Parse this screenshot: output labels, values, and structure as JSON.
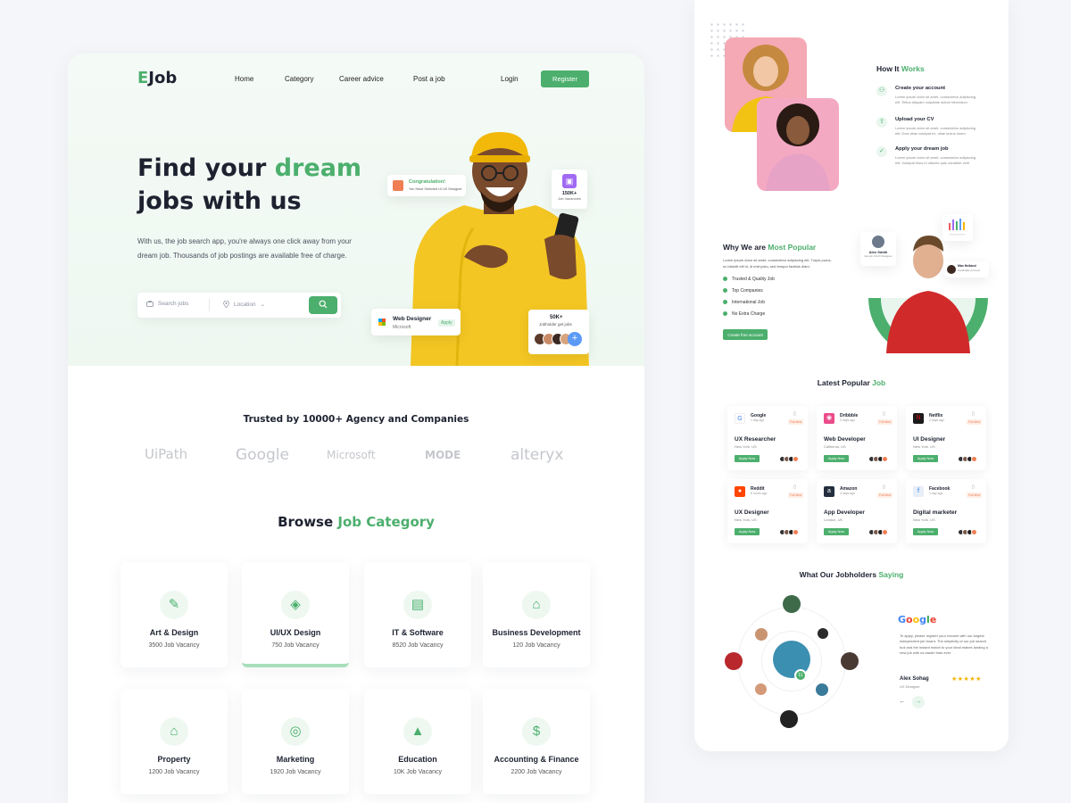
{
  "brand": {
    "logo_letter": "E",
    "logo_rest": "Job"
  },
  "nav": {
    "items": [
      "Home",
      "Category",
      "Career advice",
      "Post a job"
    ],
    "login": "Login",
    "register": "Register"
  },
  "hero": {
    "title_line1": "Find your ",
    "title_accent": "dream",
    "title_line2": "jobs  with us",
    "subtitle": "With us, the job search app, you're always one click away from your dream job. Thousands of job postings are available free of charge.",
    "search_placeholder": "Search jobs",
    "location_label": "Location"
  },
  "floating": {
    "congrats_title": "Congratulation!",
    "congrats_sub": "You Have Selected UI UX Designer",
    "vacancy_count": "150K+",
    "vacancy_label": "Job Vacancies",
    "web_designer_title": "Web Designer",
    "web_designer_company": "Microsoft",
    "web_designer_apply": "Apply",
    "jobholders_count": "50K+",
    "jobholders_label": "Jobholder get jobs",
    "plus": "+"
  },
  "trusted": {
    "title": "Trusted by 10000+ Agency and Companies",
    "brands": [
      "UiPath",
      "Google",
      "Microsoft",
      "MODE",
      "alteryx"
    ]
  },
  "browse": {
    "title_a": "Browse ",
    "title_b": "Job  Category",
    "categories": [
      {
        "name": "Art & Design",
        "count": "3500 Job Vacancy",
        "icon": "pen-tool-icon"
      },
      {
        "name": "UI/UX Design",
        "count": "750 Job Vacancy",
        "icon": "layers-icon"
      },
      {
        "name": "IT & Software",
        "count": "8520 Job Vacancy",
        "icon": "chip-icon"
      },
      {
        "name": "Business Development",
        "count": "120 Job Vacancy",
        "icon": "bank-icon"
      },
      {
        "name": "Property",
        "count": "1200 Job Vacancy",
        "icon": "home-icon"
      },
      {
        "name": "Marketing",
        "count": "1920 Job Vacancy",
        "icon": "target-icon"
      },
      {
        "name": "Education",
        "count": "10K Job Vacancy",
        "icon": "graduation-cap-icon"
      },
      {
        "name": "Accounting & Finance",
        "count": "2200 Job Vacancy",
        "icon": "dollar-icon"
      }
    ]
  },
  "how": {
    "title_a": "How It ",
    "title_b": "Works",
    "steps": [
      {
        "title": "Create your account",
        "desc": "Lorem ipsum dolor sit amet, consectetur adipiscing elit. Tellus aliquam vulputate dolore bibendum"
      },
      {
        "title": "Upload your CV",
        "desc": "Lorem ipsum dolor sit amet, consectetur adipiscing elit. Duis vitae volutpat ex, vitae luctus lorem"
      },
      {
        "title": "Apply your dream job",
        "desc": "Lorem ipsum dolor sit amet, consectetur adipiscing elit. Volutpat risus in ultrices quis curabitur velit"
      }
    ]
  },
  "why": {
    "title_a": "Why We are ",
    "title_b": "Most Popular",
    "desc": "Lorem ipsum dolor sit amet, consectetur adipiscing elit. Turpis purus, eu blandit elit id, id erat justo, sed tempor facilisis diam.",
    "items": [
      "Trusted & Quality Job",
      "Top Companies",
      "International Job",
      "No Extra Charge"
    ],
    "button": "Create free account",
    "badge1_name": "Alex Smith",
    "badge1_role": "Get job UI/UX Designer",
    "badge2_name": "Max Holland",
    "badge2_role": "Candidate Account"
  },
  "latest": {
    "title_a": "Latest Popular ",
    "title_b": "Job",
    "jobs": [
      {
        "company": "Google",
        "ago": "1 day ago",
        "type": "Full-time",
        "role": "UX Researcher",
        "loc": "New York, US",
        "apply": "Apply Now",
        "color": "#ffffff"
      },
      {
        "company": "Dribbble",
        "ago": "2 days ago",
        "type": "Full-time",
        "role": "Web Developer",
        "loc": "California, US",
        "apply": "Apply Now",
        "color": "#ea4c89"
      },
      {
        "company": "Netflix",
        "ago": "2 days ago",
        "type": "Full-time",
        "role": "UI Designer",
        "loc": "New York, US",
        "apply": "Apply Now",
        "color": "#1a1a1a"
      },
      {
        "company": "Reddit",
        "ago": "8 hours ago",
        "type": "Full-time",
        "role": "UX Designer",
        "loc": "New York, US",
        "apply": "Apply Now",
        "color": "#ff4500"
      },
      {
        "company": "Amazon",
        "ago": "4 days ago",
        "type": "Full-time",
        "role": "App Developer",
        "loc": "London, UK",
        "apply": "Apply Now",
        "color": "#232f3e"
      },
      {
        "company": "Facebook",
        "ago": "1 day ago",
        "type": "Full-time",
        "role": "Digital marketer",
        "loc": "New York, US",
        "apply": "Apply Now",
        "color": "#e8eef8"
      }
    ]
  },
  "saying": {
    "title_a": "What Our Jobholders ",
    "title_b": "Saying",
    "badge": "11",
    "google_word": "Google",
    "review": "To apply, please register your resume with our largest independent job board. The simplicity of our job search tool and the instant match to your ideal makes landing a new job with us easier than ever.",
    "name": "Alex Sohag",
    "role": "UX Designer",
    "stars": "★★★★★",
    "prev": "←",
    "next": "→"
  },
  "colors": {
    "accent": "#4caf6d",
    "orange": "#ef7e54",
    "purple": "#a06af2",
    "text": "#1d2230"
  }
}
